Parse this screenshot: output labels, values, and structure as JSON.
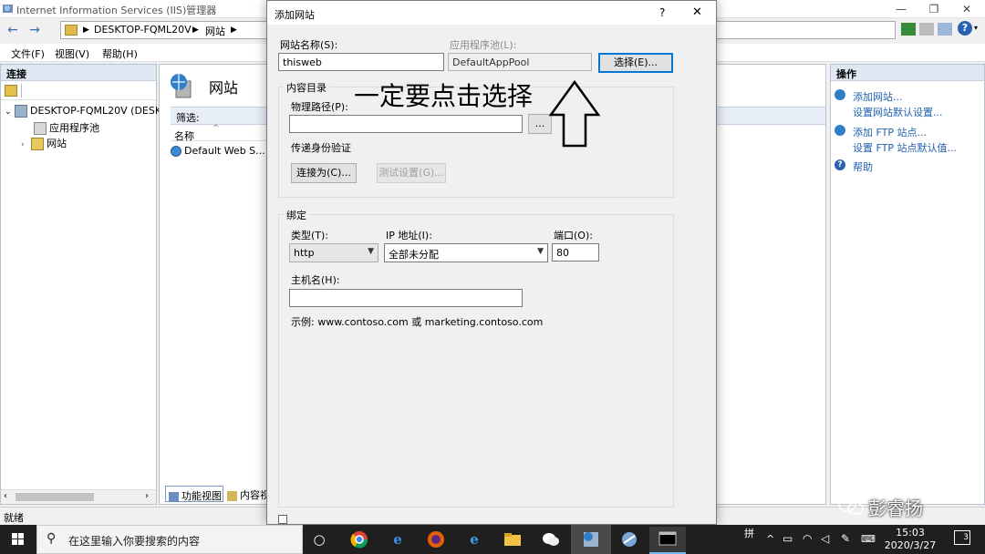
{
  "iis": {
    "title": "Internet Information Services (IIS)管理器",
    "address": [
      "DESKTOP-FQML20V",
      "网站"
    ],
    "menu": [
      "文件(F)",
      "视图(V)",
      "帮助(H)"
    ],
    "left_header": "连接",
    "tree": {
      "root": "DESKTOP-FQML20V (DESK",
      "app_pool": "应用程序池",
      "sites": "网站"
    },
    "center_title": "网站",
    "filter_label": "筛选:",
    "col_name": "名称",
    "row_site": "Default Web S...",
    "tab_features": "功能视图",
    "tab_content": "内容视",
    "right_header": "操作",
    "actions": [
      "添加网站...",
      "设置网站默认设置...",
      "添加 FTP 站点...",
      "设置 FTP 站点默认值...",
      "帮助"
    ],
    "status": "就绪"
  },
  "dialog": {
    "title": "添加网站",
    "help": "?",
    "close": "✕",
    "site_name_label": "网站名称(S):",
    "site_name_value": "thisweb",
    "app_pool_label": "应用程序池(L):",
    "app_pool_value": "DefaultAppPool",
    "select_button": "选择(E)...",
    "content_dir_label": "内容目录",
    "physical_path_label": "物理路径(P):",
    "physical_path_value": "",
    "browse_button": "...",
    "passthrough_label": "传递身份验证",
    "connect_as_button": "连接为(C)...",
    "test_settings_button": "测试设置(G)...",
    "binding_label": "绑定",
    "type_label": "类型(T):",
    "type_value": "http",
    "ip_label": "IP 地址(I):",
    "ip_value": "全部未分配",
    "port_label": "端口(O):",
    "port_value": "80",
    "host_label": "主机名(H):",
    "host_value": "",
    "example_text": "示例: www.contoso.com 或 marketing.contoso.com"
  },
  "annotation": "一定要点击选择",
  "taskbar": {
    "search_placeholder": "在这里输入你要搜索的内容",
    "time": "15:03",
    "date": "2020/3/27",
    "ime": "拼",
    "notif_count": "3"
  },
  "watermark": "彭睿扬"
}
